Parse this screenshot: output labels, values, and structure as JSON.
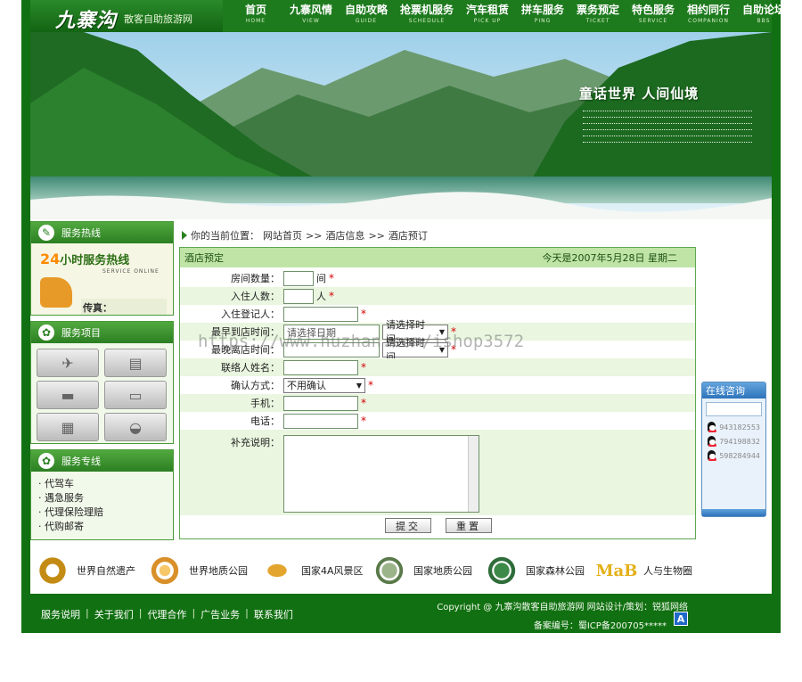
{
  "header": {
    "logo": "九寨沟",
    "logo_sub": "散客自助旅游网",
    "nav": [
      {
        "cn": "首页",
        "en": "HOME"
      },
      {
        "cn": "九寨风情",
        "en": "VIEW"
      },
      {
        "cn": "自助攻略",
        "en": "GUIDE"
      },
      {
        "cn": "抢票机服务",
        "en": "SCHEDULE"
      },
      {
        "cn": "汽车租赁",
        "en": "PICK UP"
      },
      {
        "cn": "拼车服务",
        "en": "PING"
      },
      {
        "cn": "票务预定",
        "en": "TICKET"
      },
      {
        "cn": "特色服务",
        "en": "SERVICE"
      },
      {
        "cn": "相约同行",
        "en": "COMPANION"
      },
      {
        "cn": "自助论坛",
        "en": "BBS"
      }
    ]
  },
  "banner": {
    "title": "童话世界  人间仙境"
  },
  "left": {
    "hotline_title": "服务热线",
    "hotline_big_num": "24",
    "hotline_big_text": "小时服务热线",
    "hotline_en": "SERVICE ONLINE",
    "fax_label": "传真：",
    "services_title": "服务项目",
    "dedicated_title": "服务专线",
    "dedicated": [
      "· 代驾车",
      "· 遇急服务",
      "· 代理保险理赔",
      "· 代购邮寄"
    ]
  },
  "breadcrumb": {
    "prefix": "你的当前位置：",
    "items": [
      "网站首页",
      "酒店信息",
      "酒店预订"
    ],
    "sep": ">>"
  },
  "form": {
    "title": "酒店预定",
    "date": "今天是2007年5月28日 星期二",
    "rows": {
      "rooms": {
        "label": "房间数量：",
        "unit": "间"
      },
      "guests": {
        "label": "入住人数：",
        "unit": "人"
      },
      "registrant": {
        "label": "入住登记人："
      },
      "earliest": {
        "label": "最早到店时间：",
        "date_value": "请选择日期",
        "time_value": "请选择时间"
      },
      "latest": {
        "label": "最晚离店时间：",
        "time_value": "请选择时间"
      },
      "contact": {
        "label": "联络人姓名："
      },
      "confirm": {
        "label": "确认方式：",
        "value": "不用确认"
      },
      "mobile": {
        "label": "手机："
      },
      "phone": {
        "label": "电话："
      },
      "notes": {
        "label": "补充说明："
      }
    },
    "submit": "提交",
    "reset": "重置",
    "required_mark": "*"
  },
  "watermark": "https://www.huzhan.com/ishop3572",
  "consult": {
    "title": "在线咨询",
    "qq": [
      "943182553",
      "794198832",
      "598284944"
    ]
  },
  "logos": [
    {
      "text": "世界自然遗产",
      "color": "#c48b14"
    },
    {
      "text": "世界地质公园",
      "color": "#d9902a"
    },
    {
      "text": "国家4A风景区",
      "color": "#e3a52d"
    },
    {
      "text": "国家地质公园",
      "color": "#5a7a4a"
    },
    {
      "text": "国家森林公园",
      "color": "#2f6d3a"
    },
    {
      "text": "人与生物圈",
      "color": "#e4b019"
    }
  ],
  "footer": {
    "links": [
      "服务说明",
      "关于我们",
      "代理合作",
      "广告业务",
      "联系我们"
    ],
    "copyright": "Copyright @ 九寨沟散客自助旅游网 网站设计/策划：锐狐网络",
    "icp": "备案编号：蜀ICP备200705*****",
    "a_icon": "A"
  },
  "colors": {
    "brand_green": "#117011",
    "form_header": "#bfe4a6",
    "required": "#d40000"
  }
}
